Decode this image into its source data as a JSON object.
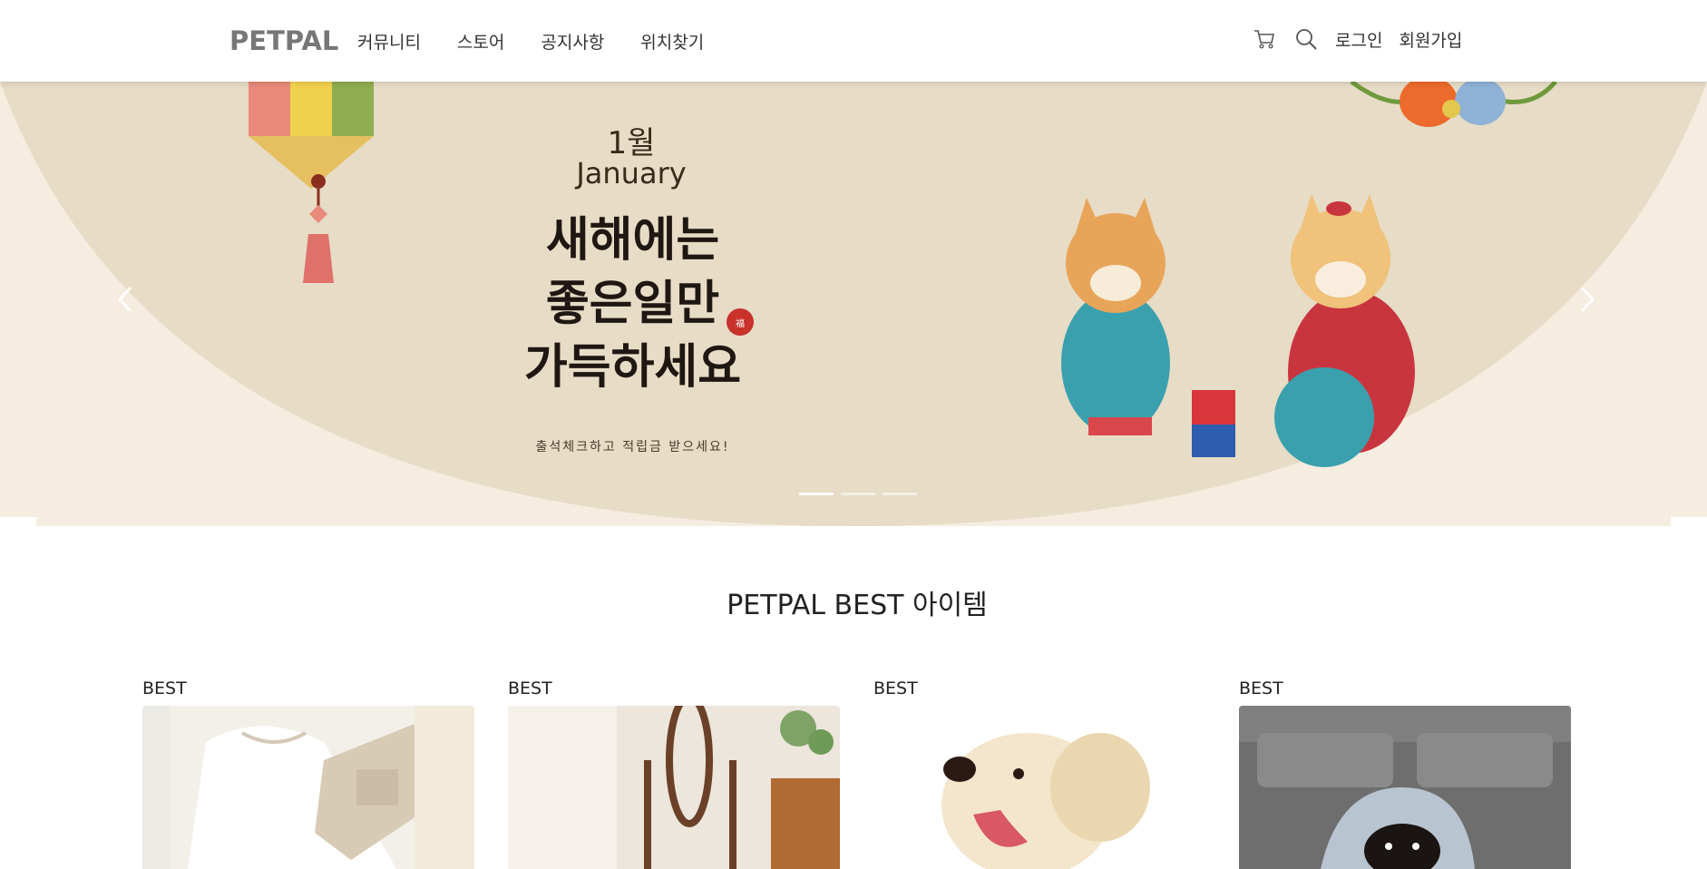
{
  "header": {
    "logo": "PETPAL",
    "nav": [
      "커뮤니티",
      "스토어",
      "공지사항",
      "위치찾기"
    ],
    "cart_icon": "cart-icon",
    "search_icon": "search-icon",
    "login": "로그인",
    "signup": "회원가입"
  },
  "banner": {
    "month_ko": "1월",
    "month_en": "January",
    "greeting_line1": "새해에는",
    "greeting_line2": "좋은일만",
    "greeting_line3": "가득하세요",
    "stamp": "福",
    "subtitle": "출석체크하고 적립금 받으세요!",
    "prev_icon": "chevron-left-icon",
    "next_icon": "chevron-right-icon",
    "slide_count": 3,
    "active_slide": 1
  },
  "best": {
    "title": "PETPAL BEST 아이템",
    "items": [
      {
        "badge": "BEST"
      },
      {
        "badge": "BEST"
      },
      {
        "badge": "BEST"
      },
      {
        "badge": "BEST"
      }
    ]
  },
  "colors": {
    "banner_bg": "#f6ede1",
    "banner_arc": "#e7dcc6",
    "logo": "#777777"
  }
}
